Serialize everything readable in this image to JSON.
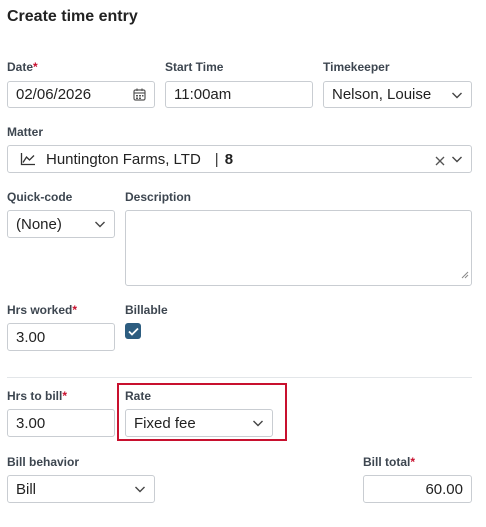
{
  "page": {
    "title": "Create time entry"
  },
  "date": {
    "label": "Date",
    "required_mark": "*",
    "value": "02/06/2026"
  },
  "start_time": {
    "label": "Start Time",
    "value": "11:00am"
  },
  "timekeeper": {
    "label": "Timekeeper",
    "value": "Nelson, Louise"
  },
  "matter": {
    "label": "Matter",
    "name": "Huntington Farms, LTD",
    "separator": "|",
    "number": "8"
  },
  "quick_code": {
    "label": "Quick-code",
    "value": "(None)"
  },
  "description": {
    "label": "Description",
    "value": ""
  },
  "hrs_worked": {
    "label": "Hrs worked",
    "required_mark": "*",
    "value": "3.00"
  },
  "billable": {
    "label": "Billable",
    "checked": true
  },
  "hrs_to_bill": {
    "label": "Hrs to bill",
    "required_mark": "*",
    "value": "3.00"
  },
  "rate": {
    "label": "Rate",
    "value": "Fixed fee"
  },
  "bill_behavior": {
    "label": "Bill behavior",
    "value": "Bill"
  },
  "bill_total": {
    "label": "Bill total",
    "required_mark": "*",
    "value": "60.00"
  },
  "colors": {
    "accent": "#2d5d80",
    "required": "#c8102e",
    "highlight": "#c8102e"
  }
}
